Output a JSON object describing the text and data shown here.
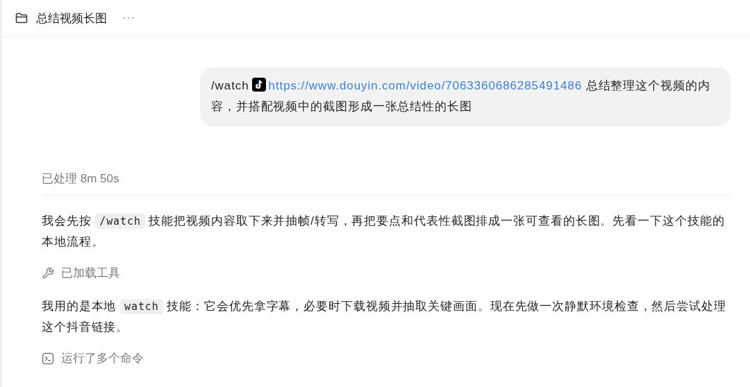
{
  "header": {
    "title": "总结视频长图",
    "more": "···"
  },
  "user_message": {
    "command": "/watch",
    "link": "https://www.douyin.com/video/7063360686285491486",
    "text": "总结整理这个视频的内容，并搭配视频中的截图形成一张总结性的长图"
  },
  "status": "已处理 8m 50s",
  "blocks": [
    {
      "kind": "paragraph",
      "segments": [
        {
          "kind": "text",
          "text": "我会先按 "
        },
        {
          "kind": "code",
          "text": "/watch"
        },
        {
          "kind": "text",
          "text": " 技能把视频内容取下来并抽帧/转写，再把要点和代表性截图排成一张可查看的长图。先看一下这个技能的本地流程。"
        }
      ]
    },
    {
      "kind": "loaded_tool",
      "label": "已加载工具"
    },
    {
      "kind": "paragraph",
      "segments": [
        {
          "kind": "text",
          "text": "我用的是本地 "
        },
        {
          "kind": "code",
          "text": "watch"
        },
        {
          "kind": "text",
          "text": " 技能：它会优先拿字幕，必要时下载视频并抽取关键画面。现在先做一次静默环境检查，然后尝试处理这个抖音链接。"
        }
      ]
    },
    {
      "kind": "commands",
      "label": "运行了多个命令"
    }
  ]
}
